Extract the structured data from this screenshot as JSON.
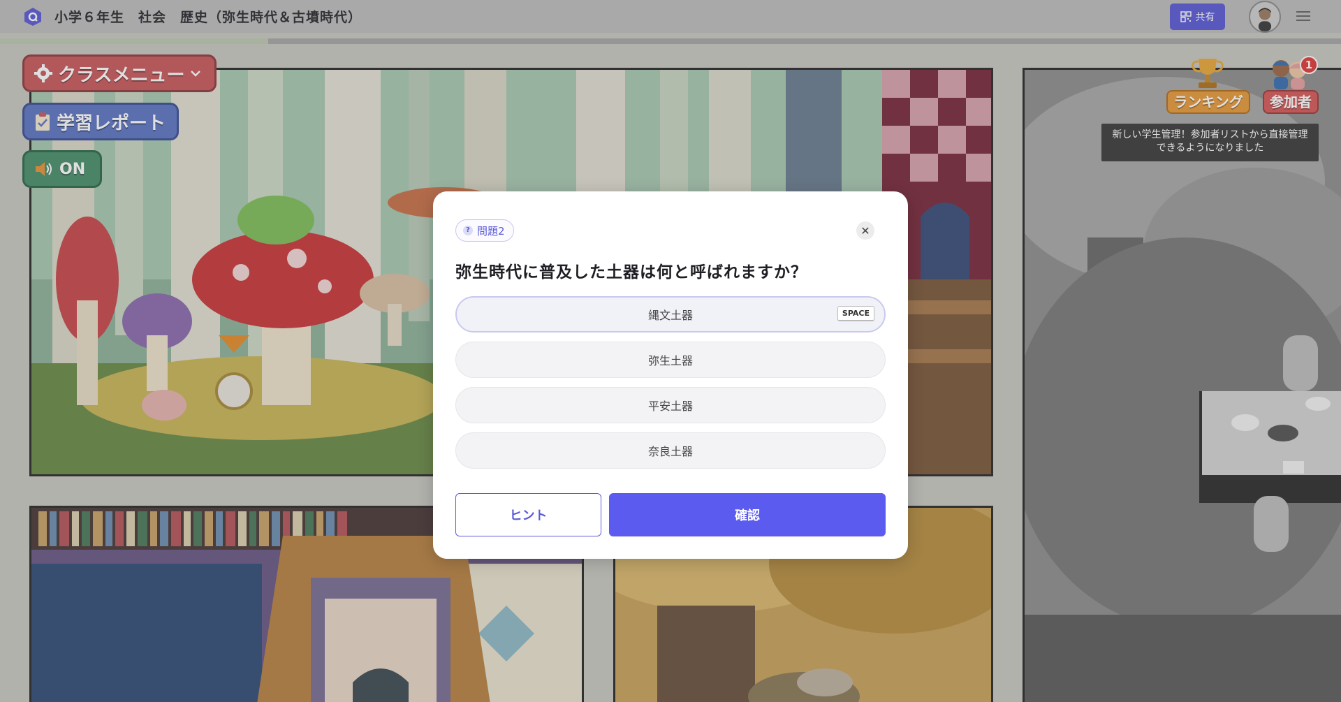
{
  "header": {
    "title": "小学６年生　社会　歴史（弥生時代＆古墳時代）",
    "share_label": "共有"
  },
  "progress": {
    "fraction": 0.2
  },
  "left_buttons": {
    "class_menu": "クラスメニュー",
    "report": "学習レポート",
    "sound": "ON"
  },
  "right_badges": {
    "ranking": "ランキング",
    "participants": "参加者",
    "notification_count": "1",
    "tooltip": "新しい学生管理！参加者リストから直接管理できるようになりました"
  },
  "modal": {
    "badge": "問題2",
    "question": "弥生時代に普及した土器は何と呼ばれますか？",
    "options": [
      {
        "label": "縄文土器",
        "shortcut": "SPACE"
      },
      {
        "label": "弥生土器"
      },
      {
        "label": "平安土器"
      },
      {
        "label": "奈良土器"
      }
    ],
    "hint_label": "ヒント",
    "confirm_label": "確認"
  },
  "colors": {
    "accent": "#5b5bf0",
    "class_menu": "#c85b5e",
    "report": "#5f77c4",
    "sound": "#4b8f6d",
    "ranking": "#e69a3c",
    "participants": "#d65b5b"
  }
}
